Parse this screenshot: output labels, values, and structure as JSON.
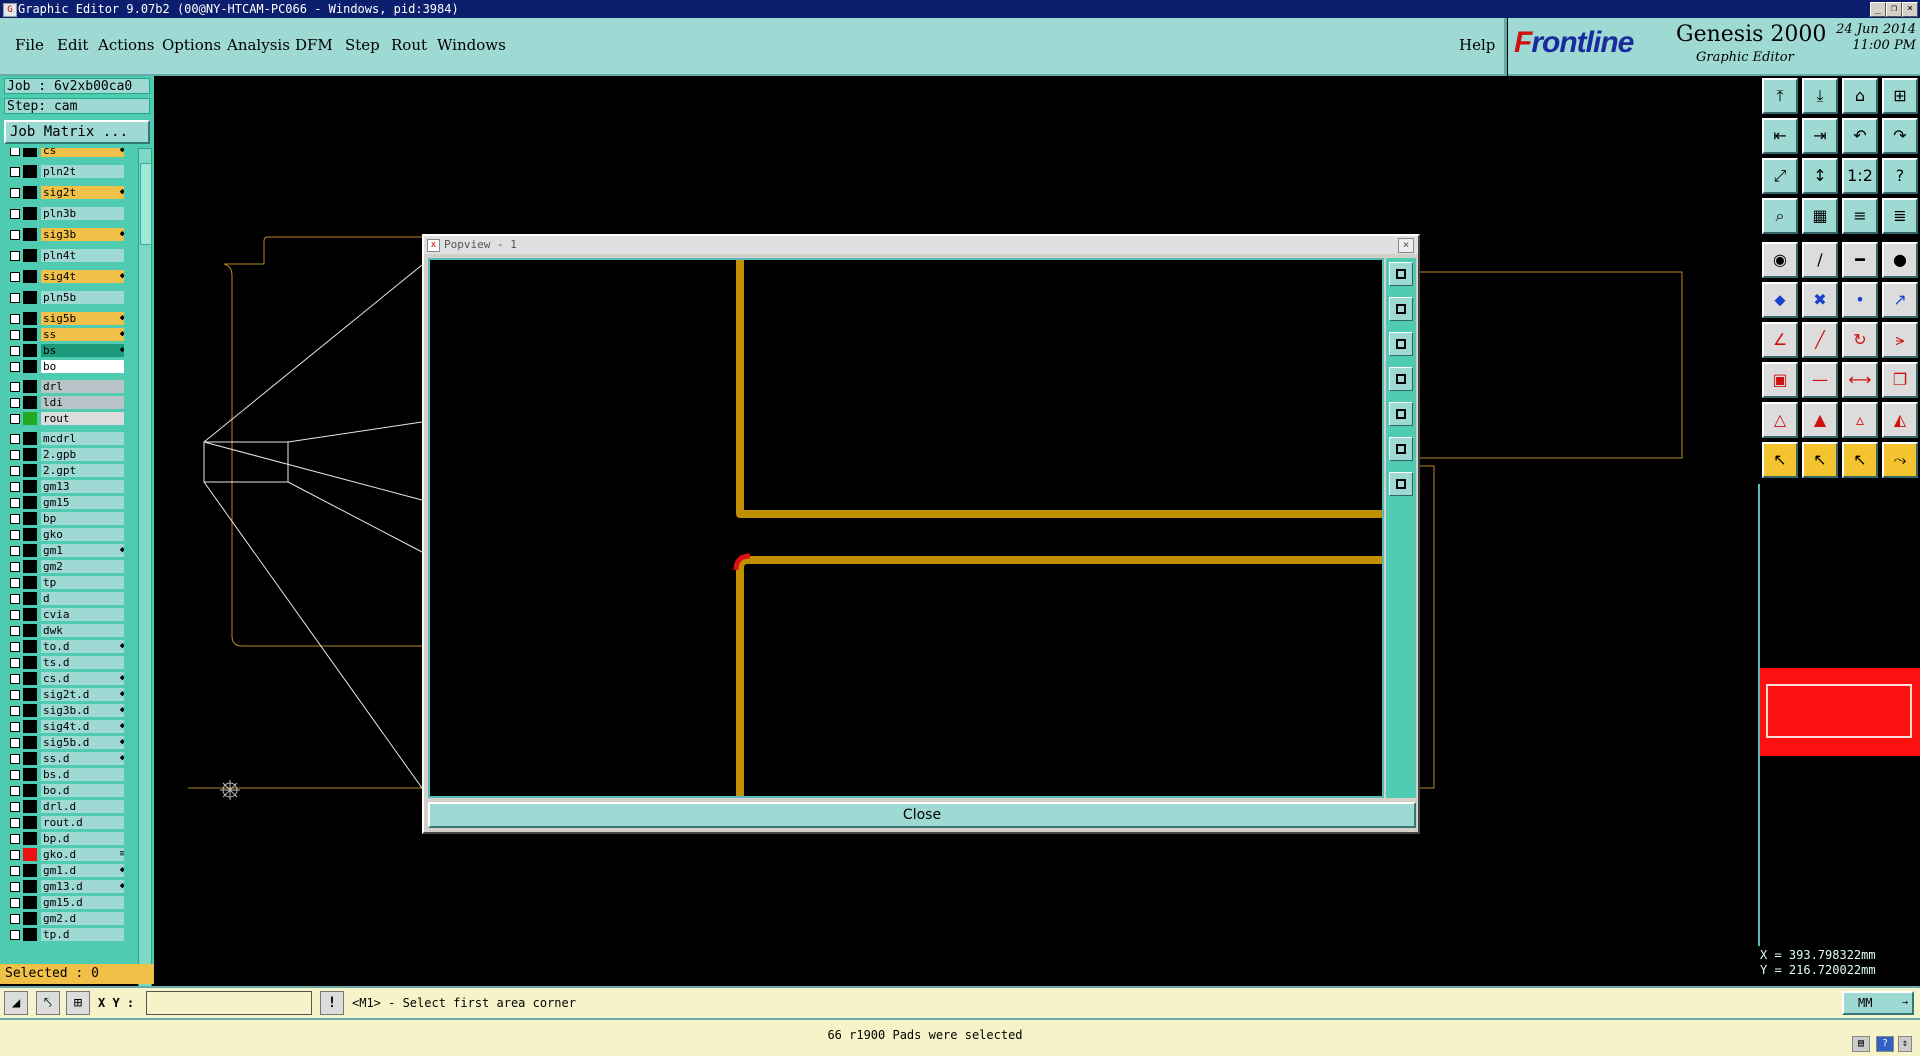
{
  "window": {
    "title": "Graphic Editor 9.07b2 (00@NY-HTCAM-PC066 - Windows, pid:3984)",
    "minimize": "_",
    "restore": "❐",
    "close": "×"
  },
  "menu": {
    "items": [
      "File",
      "Edit",
      "Actions",
      "Options",
      "Analysis",
      "DFM",
      "Step",
      "Rout",
      "Windows"
    ],
    "help": "Help"
  },
  "brand": {
    "logo_first": "F",
    "logo_rest": "rontline",
    "product": "Genesis 2000",
    "subtitle": "Graphic Editor",
    "date": "24 Jun 2014",
    "time": "11:00 PM"
  },
  "job": {
    "job_label": "Job : 6v2xb00ca0",
    "step_label": "Step: cam",
    "matrix_button": "Job Matrix ..."
  },
  "layers": [
    {
      "name": "cs",
      "color": "#f0c048",
      "mark": "◆"
    },
    {
      "name": "pln2t",
      "color": "#9fd9d4",
      "mark": ""
    },
    {
      "name": "sig2t",
      "color": "#f0c048",
      "mark": "◆"
    },
    {
      "name": "pln3b",
      "color": "#9fd9d4",
      "mark": ""
    },
    {
      "name": "sig3b",
      "color": "#f0c048",
      "mark": "◆"
    },
    {
      "name": "pln4t",
      "color": "#9fd9d4",
      "mark": ""
    },
    {
      "name": "sig4t",
      "color": "#f0c048",
      "mark": "◆"
    },
    {
      "name": "pln5b",
      "color": "#9fd9d4",
      "mark": ""
    },
    {
      "name": "sig5b",
      "color": "#f0c048",
      "mark": "◆"
    },
    {
      "name": "ss",
      "color": "#f0c048",
      "mark": "◆"
    },
    {
      "name": "bs",
      "color": "#1a9a7a",
      "mark": "◆"
    },
    {
      "name": "bo",
      "color": "#ffffff",
      "mark": ""
    },
    {
      "name": "drl",
      "color": "#b8c4c8",
      "mark": ""
    },
    {
      "name": "ldi",
      "color": "#b8c4c8",
      "mark": ""
    },
    {
      "name": "rout",
      "color": "#dcdcdc",
      "mark": ""
    },
    {
      "name": "mcdrl",
      "color": "#9fd9d4",
      "mark": ""
    },
    {
      "name": "2.gpb",
      "color": "#9fd9d4",
      "mark": ""
    },
    {
      "name": "2.gpt",
      "color": "#9fd9d4",
      "mark": ""
    },
    {
      "name": "gm13",
      "color": "#9fd9d4",
      "mark": ""
    },
    {
      "name": "gm15",
      "color": "#9fd9d4",
      "mark": ""
    },
    {
      "name": "bp",
      "color": "#9fd9d4",
      "mark": ""
    },
    {
      "name": "gko",
      "color": "#9fd9d4",
      "mark": ""
    },
    {
      "name": "gm1",
      "color": "#9fd9d4",
      "mark": "◆"
    },
    {
      "name": "gm2",
      "color": "#9fd9d4",
      "mark": ""
    },
    {
      "name": "tp",
      "color": "#9fd9d4",
      "mark": ""
    },
    {
      "name": "d",
      "color": "#9fd9d4",
      "mark": ""
    },
    {
      "name": "cvia",
      "color": "#9fd9d4",
      "mark": ""
    },
    {
      "name": "dwk",
      "color": "#9fd9d4",
      "mark": ""
    },
    {
      "name": "to.d",
      "color": "#9fd9d4",
      "mark": "◆"
    },
    {
      "name": "ts.d",
      "color": "#9fd9d4",
      "mark": ""
    },
    {
      "name": "cs.d",
      "color": "#9fd9d4",
      "mark": "◆"
    },
    {
      "name": "sig2t.d",
      "color": "#9fd9d4",
      "mark": "◆"
    },
    {
      "name": "sig3b.d",
      "color": "#9fd9d4",
      "mark": "◆"
    },
    {
      "name": "sig4t.d",
      "color": "#9fd9d4",
      "mark": "◆"
    },
    {
      "name": "sig5b.d",
      "color": "#9fd9d4",
      "mark": "◆"
    },
    {
      "name": "ss.d",
      "color": "#9fd9d4",
      "mark": "◆"
    },
    {
      "name": "bs.d",
      "color": "#9fd9d4",
      "mark": ""
    },
    {
      "name": "bo.d",
      "color": "#9fd9d4",
      "mark": ""
    },
    {
      "name": "drl.d",
      "color": "#9fd9d4",
      "mark": ""
    },
    {
      "name": "rout.d",
      "color": "#9fd9d4",
      "mark": ""
    },
    {
      "name": "bp.d",
      "color": "#9fd9d4",
      "mark": ""
    },
    {
      "name": "gko.d",
      "color": "#9fd9d4",
      "mark": "≡"
    },
    {
      "name": "gm1.d",
      "color": "#9fd9d4",
      "mark": "◆"
    },
    {
      "name": "gm13.d",
      "color": "#9fd9d4",
      "mark": "◆"
    },
    {
      "name": "gm15.d",
      "color": "#9fd9d4",
      "mark": ""
    },
    {
      "name": "gm2.d",
      "color": "#9fd9d4",
      "mark": ""
    },
    {
      "name": "tp.d",
      "color": "#9fd9d4",
      "mark": ""
    }
  ],
  "selected_label": "Selected : 0",
  "popview": {
    "title": "Popview - 1",
    "close_x": "×",
    "close_button": "Close",
    "trace_color": "#c09000"
  },
  "right_tools": [
    "open-job-icon",
    "save-icon",
    "home-icon",
    "layout-icon",
    "step-left-icon",
    "step-right-icon",
    "undo-icon",
    "redo-icon",
    "zoom-fit-icon",
    "zoom-center-icon",
    "scale-1-2-icon",
    "help-query-icon",
    "snap-icon",
    "grid-icon",
    "netlist-icon",
    "netlist-compare-icon",
    "pad-icon",
    "slash-icon",
    "measure-icon",
    "circle-icon",
    "node-icon",
    "cross-icon",
    "point-icon",
    "point-move-icon",
    "angle-icon",
    "line-icon",
    "arc-icon",
    "split-icon",
    "pad-add-icon",
    "line-add-icon",
    "dimension-icon",
    "copy-icon",
    "triangle-icon",
    "triangle-fill-icon",
    "triangle-up-icon",
    "triangle-edit-icon",
    "pointer-icon",
    "pointer-select-icon",
    "pointer-edit-icon",
    "route-icon"
  ],
  "coords": {
    "x": "X = 393.798322mm",
    "y": "Y = 216.720022mm"
  },
  "cmd": {
    "xy_label": "X Y :",
    "xy_value": "",
    "alert": "!",
    "prompt": "<M1> - Select first area corner",
    "unit": "MM"
  },
  "status": {
    "message": "66 r1900 Pads were selected"
  }
}
